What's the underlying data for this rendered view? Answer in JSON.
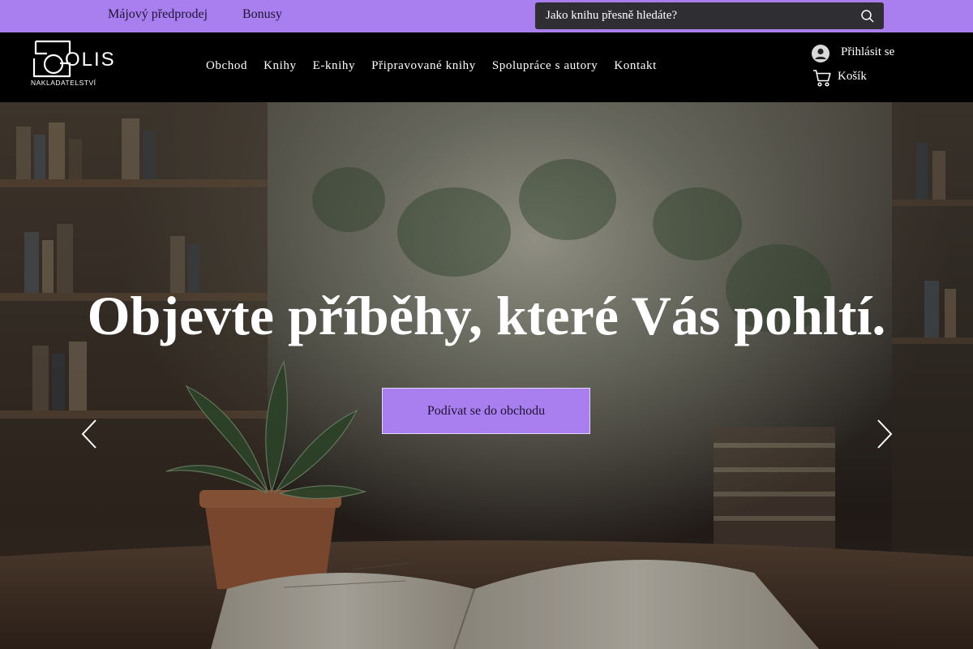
{
  "topbar": {
    "links": [
      "Májový předprodej",
      "Bonusy"
    ],
    "search_placeholder": "Jako knihu přesně hledáte?",
    "background": "#a97ff0"
  },
  "header": {
    "logo": {
      "wordmark": "OLIS",
      "subtitle": "NAKLADATELSTVÍ"
    },
    "nav": [
      "Obchod",
      "Knihy",
      "E-knihy",
      "Připravované knihy",
      "Spolupráce s autory",
      "Kontakt"
    ],
    "login_label": "Přihlásit se",
    "cart_label": "Košík"
  },
  "hero": {
    "title": "Objevte příběhy, které Vás pohltí.",
    "cta_label": "Podívat se do obchodu",
    "accent": "#a97ff0"
  }
}
